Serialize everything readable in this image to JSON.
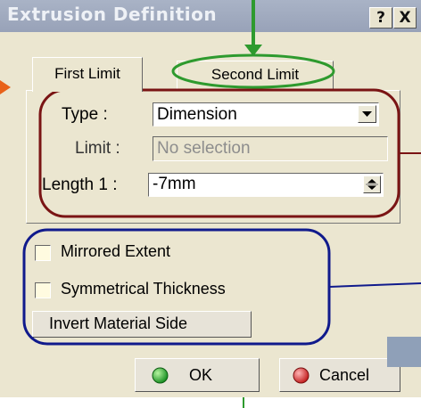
{
  "window": {
    "title": "Extrusion Definition",
    "help_label": "?",
    "close_label": "X"
  },
  "tabs": [
    {
      "label": "First Limit",
      "selected": true
    },
    {
      "label": "Second Limit",
      "selected": false
    }
  ],
  "limit": {
    "type_label": "Type :",
    "type_value": "Dimension",
    "limit_label": "Limit :",
    "limit_placeholder": "No selection",
    "length_label": "Length 1 :",
    "length_value": "-7mm"
  },
  "options": {
    "mirrored_label": "Mirrored Extent",
    "mirrored_checked": false,
    "symmetrical_label": "Symmetrical Thickness",
    "symmetrical_checked": false,
    "invert_label": "Invert Material Side"
  },
  "footer": {
    "ok_label": "OK",
    "cancel_label": "Cancel"
  },
  "colors": {
    "annotation_green": "#2e9a2e",
    "annotation_darkred": "#7a1414",
    "annotation_navy": "#101a8c",
    "annotation_arrow": "#e8621a"
  }
}
